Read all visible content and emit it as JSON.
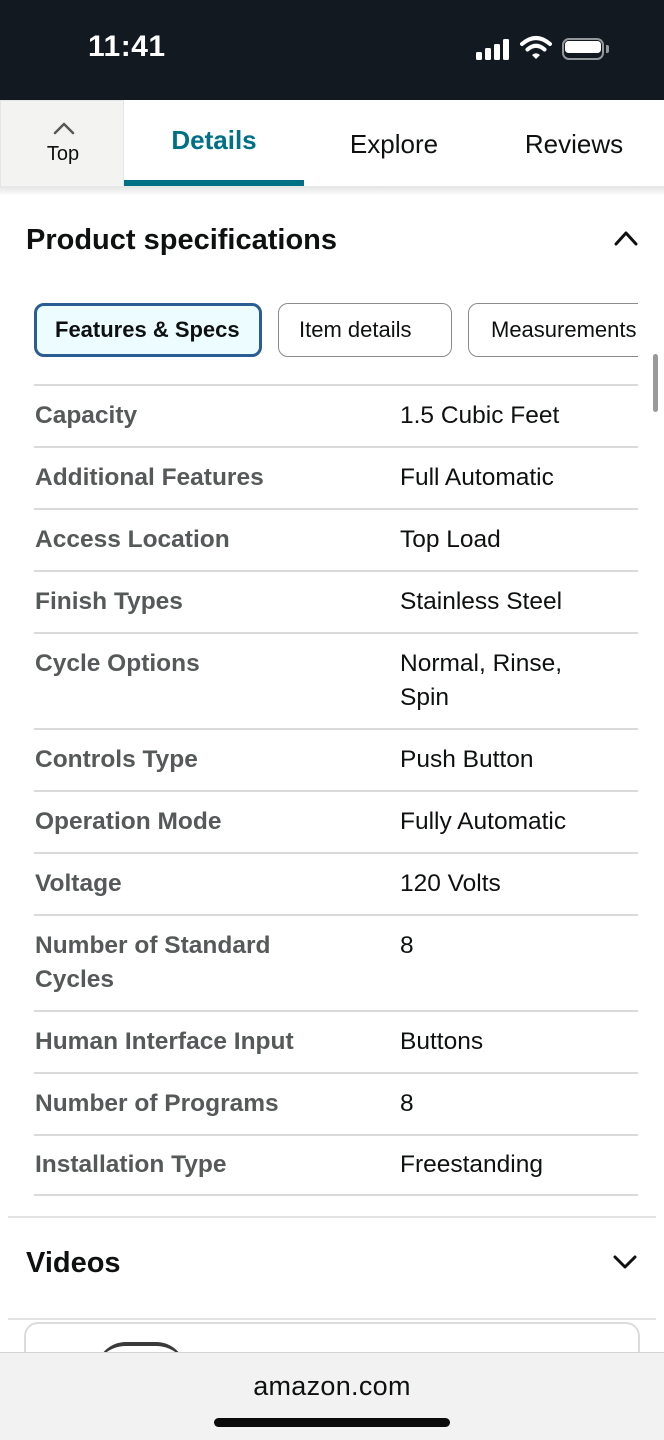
{
  "status_bar": {
    "time": "11:41",
    "signal_icon": "cellular-signal-icon",
    "wifi_icon": "wifi-icon",
    "battery_icon": "battery-icon"
  },
  "tabs": {
    "top_label": "Top",
    "top_icon": "chevron-up-icon",
    "items": [
      {
        "label": "Details",
        "active": true
      },
      {
        "label": "Explore",
        "active": false
      },
      {
        "label": "Reviews",
        "active": false
      }
    ]
  },
  "specs_section": {
    "title": "Product specifications",
    "toggle_icon": "chevron-up-icon",
    "pills": [
      {
        "label": "Features & Specs",
        "active": true
      },
      {
        "label": "Item details",
        "active": false
      },
      {
        "label": "Measurements",
        "active": false
      }
    ],
    "rows": [
      {
        "label": "Capacity",
        "value": "1.5 Cubic Feet"
      },
      {
        "label": "Additional Features",
        "value": "Full Automatic"
      },
      {
        "label": "Access Location",
        "value": "Top Load"
      },
      {
        "label": "Finish Types",
        "value": "Stainless Steel"
      },
      {
        "label": "Cycle Options",
        "value": "Normal, Rinse, Spin"
      },
      {
        "label": "Controls Type",
        "value": "Push Button"
      },
      {
        "label": "Operation Mode",
        "value": "Fully Automatic"
      },
      {
        "label": "Voltage",
        "value": "120 Volts"
      },
      {
        "label": "Number of Standard Cycles",
        "value": "8"
      },
      {
        "label": "Human Interface Input",
        "value": "Buttons"
      },
      {
        "label": "Number of Programs",
        "value": "8"
      },
      {
        "label": "Installation Type",
        "value": "Freestanding"
      }
    ]
  },
  "videos_section": {
    "title": "Videos",
    "toggle_icon": "chevron-down-icon"
  },
  "browser": {
    "url": "amazon.com"
  },
  "colors": {
    "status_bar_bg": "#131921",
    "accent_teal": "#007185",
    "active_pill_border": "#2a5d93",
    "active_pill_bg": "#edfdff"
  }
}
